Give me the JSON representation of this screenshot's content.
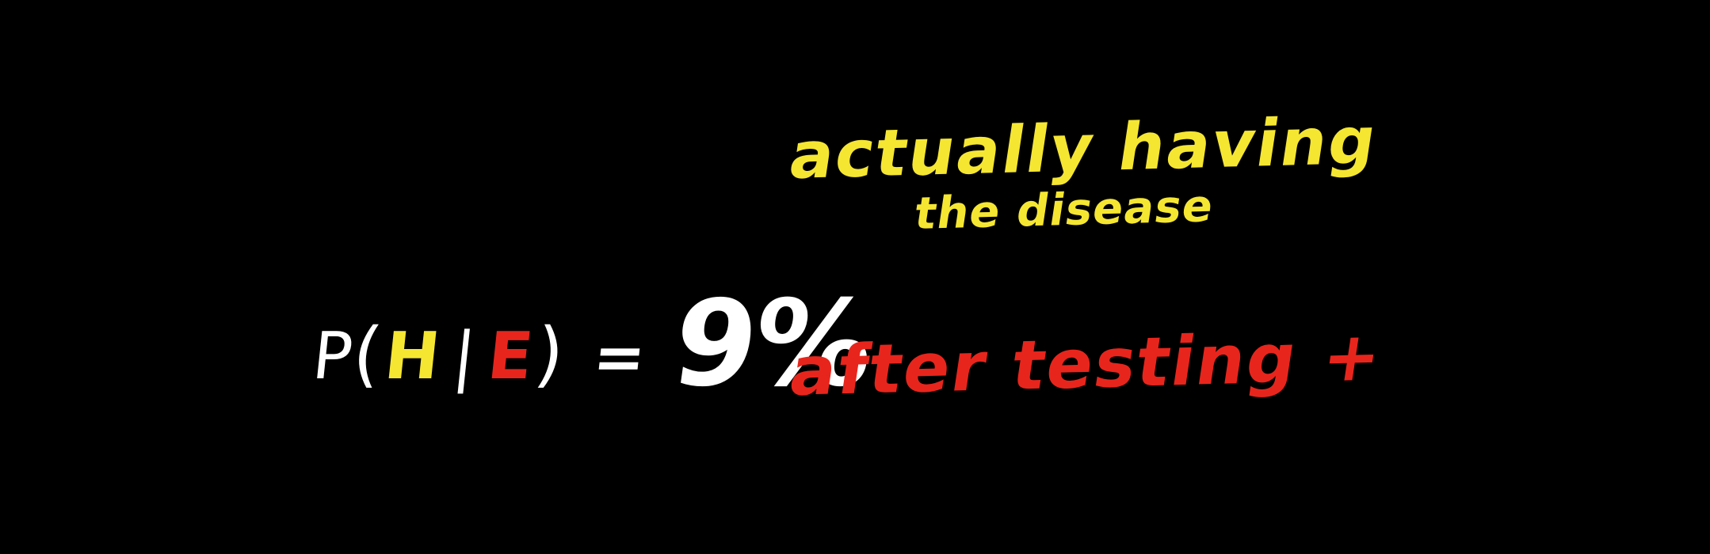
{
  "colors": {
    "background": "#000000",
    "white": "#ffffff",
    "yellow": "#f5e632",
    "red": "#e8251c"
  },
  "formula": {
    "p": "P",
    "open_paren": "(",
    "hypothesis": "H",
    "bar": "|",
    "evidence": "E",
    "close_paren": ")",
    "equals": "=",
    "result": "9%"
  },
  "annotations": {
    "hypothesis_line1": "actually having",
    "hypothesis_line2": "the disease",
    "evidence": "after testing +"
  }
}
